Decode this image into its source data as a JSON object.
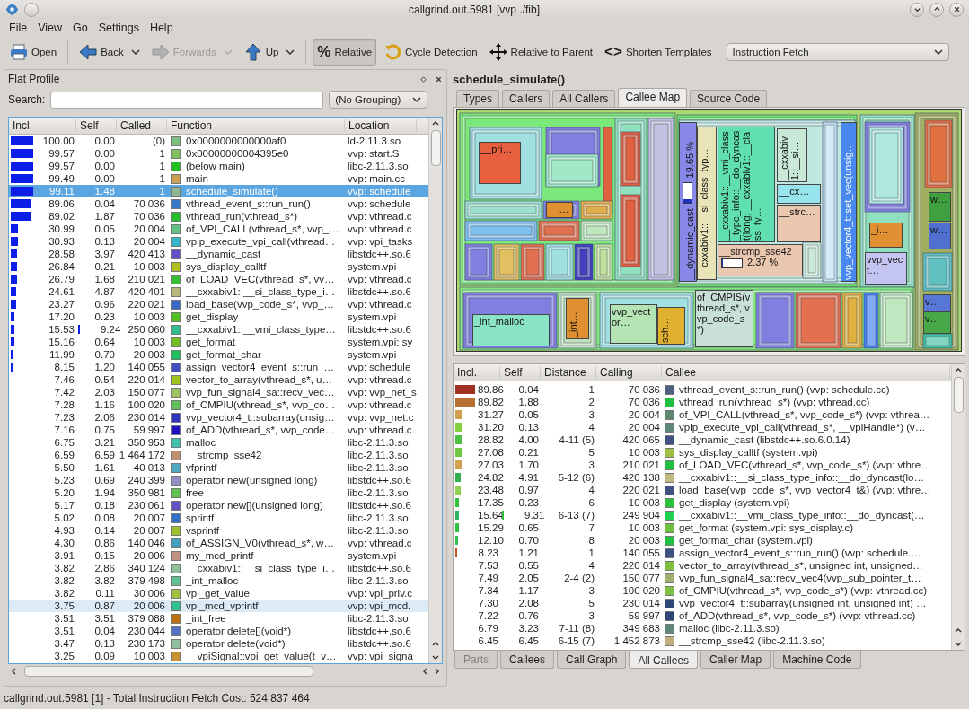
{
  "window": {
    "title": "callgrind.out.5981 [vvp ./fib]"
  },
  "menu": [
    "File",
    "View",
    "Go",
    "Settings",
    "Help"
  ],
  "toolbar": [
    {
      "kind": "open",
      "label": "Open",
      "disabled": false,
      "checked": false,
      "has_menu": false
    },
    {
      "kind": "separator"
    },
    {
      "kind": "back",
      "label": "Back",
      "disabled": false,
      "checked": false,
      "has_menu": true
    },
    {
      "kind": "forward",
      "label": "Forwards",
      "disabled": true,
      "checked": false,
      "has_menu": true
    },
    {
      "kind": "up",
      "label": "Up",
      "disabled": false,
      "checked": false,
      "has_menu": true
    },
    {
      "kind": "separator"
    },
    {
      "kind": "glyph",
      "icon": "%",
      "label": "Relative",
      "disabled": false,
      "checked": true,
      "has_menu": false
    },
    {
      "kind": "cycle",
      "label": "Cycle Detection",
      "disabled": false,
      "checked": false,
      "has_menu": false
    },
    {
      "kind": "move",
      "label": "Relative to Parent",
      "disabled": false,
      "checked": false,
      "has_menu": false
    },
    {
      "kind": "glyph",
      "icon": "<>",
      "label": "Shorten Templates",
      "disabled": false,
      "checked": false,
      "has_menu": false
    }
  ],
  "cost_type": {
    "value": "Instruction Fetch"
  },
  "flat_profile": {
    "title": "Flat Profile",
    "search_label": "Search:",
    "grouping": {
      "value": "(No Grouping)"
    },
    "columns": [
      "Incl.",
      "Self",
      "Called",
      "Function",
      "Location"
    ],
    "rows": [
      {
        "incl": "100.00",
        "level": 1.0,
        "self": "0.00",
        "called": "(0)",
        "color": "#80c080",
        "function": "0x0000000000000af0",
        "location": "ld-2.11.3.so",
        "selected": false,
        "hovered": false
      },
      {
        "incl": "99.57",
        "level": 0.9957,
        "self": "0.00",
        "called": "1",
        "color": "#80c060",
        "function": "0x00000000004395e0",
        "location": "vvp: start.S",
        "selected": false,
        "hovered": false
      },
      {
        "incl": "99.57",
        "level": 0.9957,
        "self": "0.00",
        "called": "1",
        "color": "#20c020",
        "function": "(below main)",
        "location": "libc-2.11.3.so",
        "selected": false,
        "hovered": false
      },
      {
        "incl": "99.49",
        "level": 0.9949,
        "self": "0.00",
        "called": "1",
        "color": "#c8a050",
        "function": "main",
        "location": "vvp: main.cc",
        "selected": false,
        "hovered": false
      },
      {
        "incl": "99.11",
        "level": 0.9911,
        "self": "1.48",
        "called": "1",
        "color": "#90b890",
        "function": "schedule_simulate()",
        "location": "vvp: schedule",
        "selected": true,
        "hovered": false
      },
      {
        "incl": "89.06",
        "level": 0.8906,
        "self": "0.04",
        "called": "70 036",
        "color": "#3878c8",
        "function": "vthread_event_s::run_run()",
        "location": "vvp: schedule",
        "selected": false,
        "hovered": false
      },
      {
        "incl": "89.02",
        "level": 0.8902,
        "self": "1.87",
        "called": "70 036",
        "color": "#20c030",
        "function": "vthread_run(vthread_s*)",
        "location": "vvp: vthread.c",
        "selected": false,
        "hovered": false
      },
      {
        "incl": "30.99",
        "level": 0.3099,
        "self": "0.05",
        "called": "20 004",
        "color": "#60c080",
        "function": "of_VPI_CALL(vthread_s*, vvp_…",
        "location": "vvp: vthread.c",
        "selected": false,
        "hovered": false
      },
      {
        "incl": "30.93",
        "level": 0.3093,
        "self": "0.13",
        "called": "20 004",
        "color": "#30b8c8",
        "function": "vpip_execute_vpi_call(vthread…",
        "location": "vvp: vpi_tasks",
        "selected": false,
        "hovered": false
      },
      {
        "incl": "28.58",
        "level": 0.2858,
        "self": "3.97",
        "called": "420 413",
        "color": "#6050c8",
        "function": "__dynamic_cast",
        "location": "libstdc++.so.6",
        "selected": false,
        "hovered": false
      },
      {
        "incl": "26.84",
        "level": 0.2684,
        "self": "0.21",
        "called": "10 003",
        "color": "#b0c020",
        "function": "sys_display_calltf",
        "location": "system.vpi",
        "selected": false,
        "hovered": false
      },
      {
        "incl": "26.79",
        "level": 0.2679,
        "self": "1.68",
        "called": "210 021",
        "color": "#30c030",
        "function": "of_LOAD_VEC(vthread_s*, vv…",
        "location": "vvp: vthread.c",
        "selected": false,
        "hovered": false
      },
      {
        "incl": "24.61",
        "level": 0.2461,
        "self": "4.87",
        "called": "420 401",
        "color": "#b8b880",
        "function": "__cxxabiv1::__si_class_type_i…",
        "location": "libstdc++.so.6",
        "selected": false,
        "hovered": false
      },
      {
        "incl": "23.27",
        "level": 0.2327,
        "self": "0.96",
        "called": "220 021",
        "color": "#3868c8",
        "function": "load_base(vvp_code_s*, vvp_…",
        "location": "vvp: vthread.c",
        "selected": false,
        "hovered": false
      },
      {
        "incl": "17.20",
        "level": 0.172,
        "self": "0.23",
        "called": "10 003",
        "color": "#50c020",
        "function": "get_display",
        "location": "system.vpi",
        "selected": false,
        "hovered": false
      },
      {
        "incl": "15.53",
        "level": 0.1553,
        "self": "9.24",
        "self_bar": {
          "level": 0.0924
        },
        "called": "250 060",
        "color": "#30c090",
        "function": "__cxxabiv1::__vmi_class_type…",
        "location": "libstdc++.so.6",
        "selected": false,
        "hovered": false
      },
      {
        "incl": "15.16",
        "level": 0.1516,
        "self": "0.64",
        "called": "10 003",
        "color": "#70c020",
        "function": "get_format",
        "location": "system.vpi: sy",
        "selected": false,
        "hovered": false
      },
      {
        "incl": "11.99",
        "level": 0.1199,
        "self": "0.70",
        "called": "20 003",
        "color": "#20c060",
        "function": "get_format_char",
        "location": "system.vpi",
        "selected": false,
        "hovered": false
      },
      {
        "incl": "8.15",
        "level": 0.0815,
        "self": "1.20",
        "called": "140 055",
        "color": "#4050c0",
        "function": "assign_vector4_event_s::run_…",
        "location": "vvp: schedule",
        "selected": false,
        "hovered": false
      },
      {
        "incl": "7.46",
        "self": "0.54",
        "called": "220 014",
        "color": "#a0c020",
        "function": "vector_to_array(vthread_s*, u…",
        "location": "vvp: vthread.c",
        "selected": false,
        "hovered": false
      },
      {
        "incl": "7.42",
        "self": "2.03",
        "called": "150 077",
        "color": "#a0c060",
        "function": "vvp_fun_signal4_sa::recv_vec…",
        "location": "vvp: vvp_net_s",
        "selected": false,
        "hovered": false
      },
      {
        "incl": "7.28",
        "self": "1.16",
        "called": "100 020",
        "color": "#60c060",
        "function": "of_CMPIU(vthread_s*, vvp_co…",
        "location": "vvp: vthread.c",
        "selected": false,
        "hovered": false
      },
      {
        "incl": "7.23",
        "self": "2.06",
        "called": "230 014",
        "color": "#3030c0",
        "function": "vvp_vector4_t::subarray(unsig…",
        "location": "vvp: vvp_net.c",
        "selected": false,
        "hovered": false
      },
      {
        "incl": "7.16",
        "self": "0.75",
        "called": "59 997",
        "color": "#2010c0",
        "function": "of_ADD(vthread_s*, vvp_code…",
        "location": "vvp: vthread.c",
        "selected": false,
        "hovered": false
      },
      {
        "incl": "6.75",
        "self": "3.21",
        "called": "350 953",
        "color": "#40c0b0",
        "function": "malloc",
        "location": "libc-2.11.3.so",
        "selected": false,
        "hovered": false
      },
      {
        "incl": "6.59",
        "self": "6.59",
        "called": "1 464 172",
        "color": "#c09070",
        "function": "__strcmp_sse42",
        "location": "libc-2.11.3.so",
        "selected": false,
        "hovered": false
      },
      {
        "incl": "5.50",
        "self": "1.61",
        "called": "40 013",
        "color": "#50a8c0",
        "function": "vfprintf",
        "location": "libc-2.11.3.so",
        "selected": false,
        "hovered": false
      },
      {
        "incl": "5.23",
        "self": "0.69",
        "called": "240 399",
        "color": "#9090c0",
        "function": "operator new(unsigned long)",
        "location": "libstdc++.so.6",
        "selected": false,
        "hovered": false
      },
      {
        "incl": "5.20",
        "self": "1.94",
        "called": "350 981",
        "color": "#60c050",
        "function": "free",
        "location": "libc-2.11.3.so",
        "selected": false,
        "hovered": false
      },
      {
        "incl": "5.17",
        "self": "0.18",
        "called": "230 061",
        "color": "#6050c0",
        "function": "operator new[](unsigned long)",
        "location": "libstdc++.so.6",
        "selected": false,
        "hovered": false
      },
      {
        "incl": "5.02",
        "self": "0.08",
        "called": "20 007",
        "color": "#3070c8",
        "function": "sprintf",
        "location": "libc-2.11.3.so",
        "selected": false,
        "hovered": false
      },
      {
        "incl": "4.93",
        "self": "0.14",
        "called": "20 007",
        "color": "#a0c030",
        "function": "vsprintf",
        "location": "libc-2.11.3.so",
        "selected": false,
        "hovered": false
      },
      {
        "incl": "4.30",
        "self": "0.86",
        "called": "140 046",
        "color": "#40a0c0",
        "function": "of_ASSIGN_V0(vthread_s*, w…",
        "location": "vvp: vthread.c",
        "selected": false,
        "hovered": false
      },
      {
        "incl": "3.91",
        "self": "0.15",
        "called": "20 006",
        "color": "#c09080",
        "function": "my_mcd_printf",
        "location": "system.vpi",
        "selected": false,
        "hovered": false
      },
      {
        "incl": "3.82",
        "self": "2.86",
        "called": "340 124",
        "color": "#90c0a0",
        "function": "__cxxabiv1::__si_class_type_i…",
        "location": "libstdc++.so.6",
        "selected": false,
        "hovered": false
      },
      {
        "incl": "3.82",
        "self": "3.82",
        "called": "379 498",
        "color": "#60c090",
        "function": "_int_malloc",
        "location": "libc-2.11.3.so",
        "selected": false,
        "hovered": false
      },
      {
        "incl": "3.82",
        "self": "0.11",
        "called": "30 006",
        "color": "#a0c040",
        "function": "vpi_get_value",
        "location": "vvp: vpi_priv.c",
        "selected": false,
        "hovered": false
      },
      {
        "incl": "3.75",
        "self": "0.87",
        "called": "20 006",
        "color": "#30c090",
        "function": "vpi_mcd_vprintf",
        "location": "vvp: vpi_mcd.",
        "selected": false,
        "hovered": true
      },
      {
        "incl": "3.51",
        "self": "3.51",
        "called": "379 088",
        "color": "#c07010",
        "function": "_int_free",
        "location": "libc-2.11.3.so",
        "selected": false,
        "hovered": false
      },
      {
        "incl": "3.51",
        "self": "0.04",
        "called": "230 044",
        "color": "#5070c0",
        "function": "operator delete[](void*)",
        "location": "libstdc++.so.6",
        "selected": false,
        "hovered": false
      },
      {
        "incl": "3.47",
        "self": "0.13",
        "called": "230 173",
        "color": "#90c0a0",
        "function": "operator delete(void*)",
        "location": "libstdc++.so.6",
        "selected": false,
        "hovered": false
      },
      {
        "incl": "3.25",
        "self": "0.09",
        "called": "10 003",
        "color": "#c89030",
        "function": "__vpiSignal::vpi_get_value(t_v…",
        "location": "vvp: vpi_signa",
        "selected": false,
        "hovered": false
      }
    ]
  },
  "detail": {
    "function": "schedule_simulate()",
    "tabs": [
      {
        "label": "Types",
        "selected": false
      },
      {
        "label": "Callers",
        "selected": false
      },
      {
        "label": "All Callers",
        "selected": false
      },
      {
        "label": "Callee Map",
        "selected": true
      },
      {
        "label": "Source Code",
        "selected": false
      }
    ],
    "callee_map": {
      "cells": [
        {
          "label": "__pri…",
          "color": "#e86040",
          "kind": "horizontal"
        },
        {
          "label": "__…",
          "color": "#e09030",
          "kind": "horizontal"
        },
        {
          "label": "__dynamic_cast",
          "color": "#8888e8",
          "kind": "vertical",
          "percent": {
            "text": "19.65 %",
            "level": 0.1965
          }
        },
        {
          "label": "__cxxabiv1::__si_class_typ…",
          "color": "#e8e4b8",
          "kind": "vertical"
        },
        {
          "label": "__cxxabiv1::__vmi_class_type_info::__do_dyncast(long, __cxxabiv1::__class_ty…",
          "color": "#60e0b0",
          "kind": "vertical"
        },
        {
          "label": "__cxxabiv1::__si…",
          "color": "#c8e8d8",
          "kind": "vertical"
        },
        {
          "label": "__cx…",
          "color": "#98e4ec",
          "kind": "horizontal"
        },
        {
          "label": "__strc…",
          "color": "#eac8b0",
          "kind": "horizontal"
        },
        {
          "label": "__strcmp_sse42",
          "color": "#eac8b0",
          "kind": "horizontal",
          "percent": {
            "text": "2.37 %",
            "level": 0.0237
          }
        },
        {
          "label": "vvp_vector4_t::set_vec(unsig…",
          "color": "#4888f0",
          "kind": "vertical"
        },
        {
          "label": "_i…",
          "color": "#e09030",
          "kind": "horizontal"
        },
        {
          "label": "vvp_vect…",
          "color": "#c4c4f0",
          "kind": "horizontal"
        },
        {
          "label": "w…",
          "color": "#40a040",
          "kind": "horizontal"
        },
        {
          "label": "w…",
          "color": "#5070d0",
          "kind": "horizontal"
        },
        {
          "label": "_int_malloc",
          "color": "#88e4c4",
          "kind": "horizontal"
        },
        {
          "label": "_int…",
          "color": "#e09030",
          "kind": "vertical"
        },
        {
          "label": "vvp_vector…",
          "color": "#b4e4b4",
          "kind": "horizontal"
        },
        {
          "label": "sch…",
          "color": "#e0b030",
          "kind": "vertical"
        },
        {
          "label": "of_CMPIS(vthread_s*, vvp_code_s*)",
          "color": "#c8e0d8",
          "kind": "horizontal"
        },
        {
          "label": "v…",
          "color": "#5878d8",
          "kind": "horizontal"
        },
        {
          "label": "v…",
          "color": "#48a848",
          "kind": "horizontal"
        }
      ]
    },
    "callees": {
      "columns": [
        "Incl.",
        "Self",
        "Distance",
        "Calling",
        "Callee"
      ],
      "rows": [
        {
          "incl": "89.86",
          "bar": {
            "level": 0.8986,
            "color": "#a03020"
          },
          "self": "0.04",
          "distance": "1",
          "calling": "70 036",
          "color": "#506080",
          "callee": "vthread_event_s::run_run() (vvp: schedule.cc)"
        },
        {
          "incl": "89.82",
          "bar": {
            "level": 0.8982,
            "color": "#b87030"
          },
          "self": "1.88",
          "distance": "2",
          "calling": "70 036",
          "color": "#20c040",
          "callee": "vthread_run(vthread_s*) (vvp: vthread.cc)"
        },
        {
          "incl": "31.27",
          "bar": {
            "level": 0.3127,
            "color": "#d0a050"
          },
          "self": "0.05",
          "distance": "3",
          "calling": "20 004",
          "color": "#608870",
          "callee": "of_VPI_CALL(vthread_s*, vvp_code_s*) (vvp: vthrea…"
        },
        {
          "incl": "31.20",
          "bar": {
            "level": 0.312,
            "color": "#80d040"
          },
          "self": "0.13",
          "distance": "4",
          "calling": "20 004",
          "color": "#608878",
          "callee": "vpip_execute_vpi_call(vthread_s*, __vpiHandle*) (v…"
        },
        {
          "incl": "28.82",
          "bar": {
            "level": 0.2882,
            "color": "#50c040"
          },
          "self": "4.00",
          "distance": "4-11 (5)",
          "calling": "420 065",
          "color": "#405080",
          "callee": "__dynamic_cast (libstdc++.so.6.0.14)"
        },
        {
          "incl": "27.08",
          "bar": {
            "level": 0.2708,
            "color": "#70c840"
          },
          "self": "0.21",
          "distance": "5",
          "calling": "10 003",
          "color": "#a0c040",
          "callee": "sys_display_calltf (system.vpi)"
        },
        {
          "incl": "27.03",
          "bar": {
            "level": 0.2703,
            "color": "#d0a050"
          },
          "self": "1.70",
          "distance": "3",
          "calling": "210 021",
          "color": "#20c040",
          "callee": "of_LOAD_VEC(vthread_s*, vvp_code_s*) (vvp: vthre…"
        },
        {
          "incl": "24.82",
          "bar": {
            "level": 0.2482,
            "color": "#30b050"
          },
          "self": "4.91",
          "distance": "5-12 (6)",
          "calling": "420 138",
          "color": "#c0b880",
          "callee": "__cxxabiv1::__si_class_type_info::__do_dyncast(lo…"
        },
        {
          "incl": "23.48",
          "bar": {
            "level": 0.2348,
            "color": "#90d050"
          },
          "self": "0.97",
          "distance": "4",
          "calling": "220 021",
          "color": "#405080",
          "callee": "load_base(vvp_code_s*, vvp_vector4_t&) (vvp: vthre…"
        },
        {
          "incl": "17.35",
          "bar": {
            "level": 0.1735,
            "color": "#30c040"
          },
          "self": "0.23",
          "distance": "6",
          "calling": "10 003",
          "color": "#30c040",
          "callee": "get_display (system.vpi)"
        },
        {
          "incl": "15.64",
          "bar": {
            "level": 0.1564,
            "color": "#30b060"
          },
          "self": "9.31",
          "self_bar": {
            "level": 0.0931,
            "color": "#30c040"
          },
          "distance": "6-13 (7)",
          "calling": "249 904",
          "color": "#20d050",
          "callee": "__cxxabiv1::__vmi_class_type_info::__do_dyncast(…"
        },
        {
          "incl": "15.29",
          "bar": {
            "level": 0.1529,
            "color": "#30c040"
          },
          "self": "0.65",
          "distance": "7",
          "calling": "10 003",
          "color": "#70c040",
          "callee": "get_format (system.vpi: sys_display.c)"
        },
        {
          "incl": "12.10",
          "bar": {
            "level": 0.121,
            "color": "#30c050"
          },
          "self": "0.70",
          "distance": "8",
          "calling": "20 003",
          "color": "#20c040",
          "callee": "get_format_char (system.vpi)"
        },
        {
          "incl": "8.23",
          "bar": {
            "level": 0.0823,
            "color": "#c05020"
          },
          "self": "1.21",
          "distance": "1",
          "calling": "140 055",
          "color": "#405080",
          "callee": "assign_vector4_event_s::run_run() (vvp: schedule.…"
        },
        {
          "incl": "7.53",
          "self": "0.55",
          "distance": "4",
          "calling": "220 014",
          "color": "#80c040",
          "callee": "vector_to_array(vthread_s*, unsigned int, unsigned…"
        },
        {
          "incl": "7.49",
          "self": "2.05",
          "distance": "2-4 (2)",
          "calling": "150 077",
          "color": "#a0b070",
          "callee": "vvp_fun_signal4_sa::recv_vec4(vvp_sub_pointer_t…"
        },
        {
          "incl": "7.34",
          "self": "1.17",
          "distance": "3",
          "calling": "100 020",
          "color": "#80c040",
          "callee": "of_CMPIU(vthread_s*, vvp_code_s*) (vvp: vthread.cc)"
        },
        {
          "incl": "7.30",
          "self": "2.08",
          "distance": "5",
          "calling": "230 014",
          "color": "#304878",
          "callee": "vvp_vector4_t::subarray(unsigned int, unsigned int) …"
        },
        {
          "incl": "7.22",
          "self": "0.76",
          "distance": "3",
          "calling": "59 997",
          "color": "#304878",
          "callee": "of_ADD(vthread_s*, vvp_code_s*) (vvp: vthread.cc)"
        },
        {
          "incl": "6.79",
          "self": "3.23",
          "distance": "7-11 (8)",
          "calling": "349 683",
          "color": "#608878",
          "callee": "malloc (libc-2.11.3.so)"
        },
        {
          "incl": "6.45",
          "self": "6.45",
          "distance": "6-15 (7)",
          "calling": "1 452 873",
          "color": "#c0b080",
          "callee": "__strcmp_sse42 (libc-2.11.3.so)"
        }
      ]
    },
    "bottom_tabs": [
      {
        "label": "Parts",
        "selected": false,
        "disabled": true
      },
      {
        "label": "Callees",
        "selected": false,
        "disabled": false
      },
      {
        "label": "Call Graph",
        "selected": false,
        "disabled": false
      },
      {
        "label": "All Callees",
        "selected": true,
        "disabled": false
      },
      {
        "label": "Caller Map",
        "selected": false,
        "disabled": false
      },
      {
        "label": "Machine Code",
        "selected": false,
        "disabled": false
      }
    ]
  },
  "status_bar": "callgrind.out.5981 [1] - Total Instruction Fetch Cost: 524 837 464"
}
